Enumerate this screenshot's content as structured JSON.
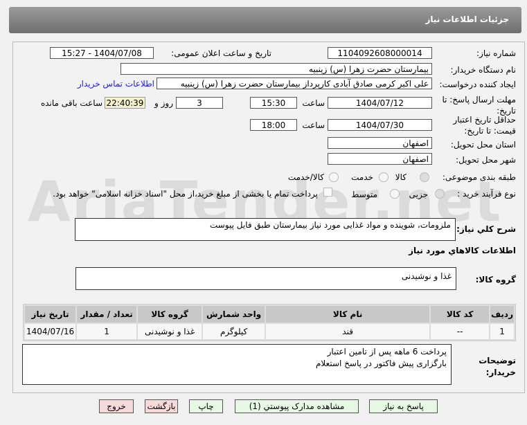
{
  "header": {
    "title": "جزئیات اطلاعات نیاز"
  },
  "watermark": "AriaTender.net",
  "form": {
    "need_number_label": "شماره نیاز:",
    "need_number": "1104092608000014",
    "announce_label": "تاریخ و ساعت اعلان عمومی:",
    "announce_value": "1404/07/08 - 15:27",
    "buyer_label": "نام دستگاه خریدار:",
    "buyer": "بیمارستان حضرت زهرا (س) زینبیه",
    "creator_label": "ایجاد کننده درخواست:",
    "creator": "علی اکبر کرمی صادق آبادی کارپرداز بیمارستان حضرت زهرا (س) زینبیه",
    "contact_link": "اطلاعات تماس خریدار",
    "deadline_label": "مهلت ارسال پاسخ: تا تاریخ:",
    "deadline_date": "1404/07/12",
    "time_label": "ساعت",
    "deadline_time": "15:30",
    "days": "3",
    "days_label": "روز و",
    "remaining": "22:40:39",
    "remaining_label": "ساعت باقی مانده",
    "validity_label": "حداقل تاریخ اعتبار قیمت: تا تاریخ:",
    "validity_date": "1404/07/30",
    "validity_time": "18:00",
    "province_label": "استان محل تحویل:",
    "province": "اصفهان",
    "city_label": "شهر محل تحویل:",
    "city": "اصفهان",
    "category_label": "طبقه بندی موضوعی:",
    "category_options": [
      "کالا",
      "خدمت",
      "کالا/خدمت"
    ],
    "category_selected": "کالا",
    "process_label": "نوع فرآیند خرید :",
    "process_options": [
      "جزیی",
      "متوسط"
    ],
    "payment_note": "پرداخت تمام یا بخشی از مبلغ خرید،از محل \"اسناد خزانه اسلامی\" خواهد بود.",
    "description_label": "شرح کلي نياز:",
    "description": "ملزومات، شوینده و مواد غذایی مورد نیاز بیمارستان طبق فایل پیوست",
    "goods_info_title": "اطلاعات کالاهاي مورد نياز",
    "goods_group_label": "گروه کالا:",
    "goods_group": "غذا و نوشیدنی"
  },
  "table": {
    "headers": [
      "ردیف",
      "کد کالا",
      "نام کالا",
      "واحد شمارش",
      "گروه کالا",
      "تعداد / مقدار",
      "تاریخ نیاز"
    ],
    "rows": [
      [
        "1",
        "--",
        "قند",
        "کیلوگرم",
        "غذا و نوشیدنی",
        "1",
        "1404/07/16"
      ]
    ]
  },
  "notes": {
    "label": "توضیحات خریدار:",
    "lines": [
      "پرداخت 6 ماهه پس از تامین اعتبار",
      "بارگزاری پیش فاکتور در پاسخ استعلام"
    ]
  },
  "buttons": {
    "reply": "پاسخ به نیاز",
    "attachments": "مشاهده مدارک پیوستي (1)",
    "print": "چاپ",
    "back": "بازگشت",
    "exit": "خروج"
  }
}
